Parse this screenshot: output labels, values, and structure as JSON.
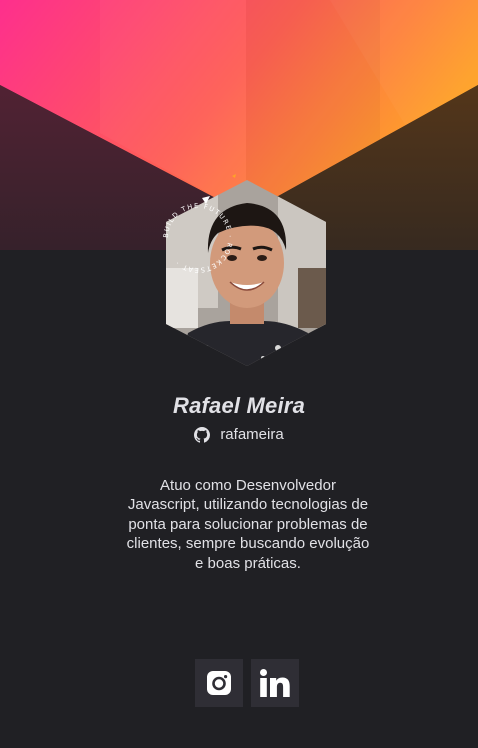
{
  "theme": {
    "background": "#202024",
    "gradient_start": "#fe2f8d",
    "gradient_end": "#fea228",
    "text": "#e1e1e6",
    "icon_button_bg": "#2f2e35"
  },
  "profile": {
    "name": "Rafael Meira",
    "github_username": "rafameira",
    "bio": "Atuo como Desenvolvedor Javascript, utilizando tecnologias de ponta para solucionar problemas de clientes, sempre buscando evolução e boas práticas.",
    "avatar_badge_text": "BUILD THE FUTURE · ROCKETSEAT ·"
  },
  "socials": [
    {
      "network": "Instagram",
      "icon": "instagram-icon"
    },
    {
      "network": "LinkedIn",
      "icon": "linkedin-icon"
    }
  ]
}
